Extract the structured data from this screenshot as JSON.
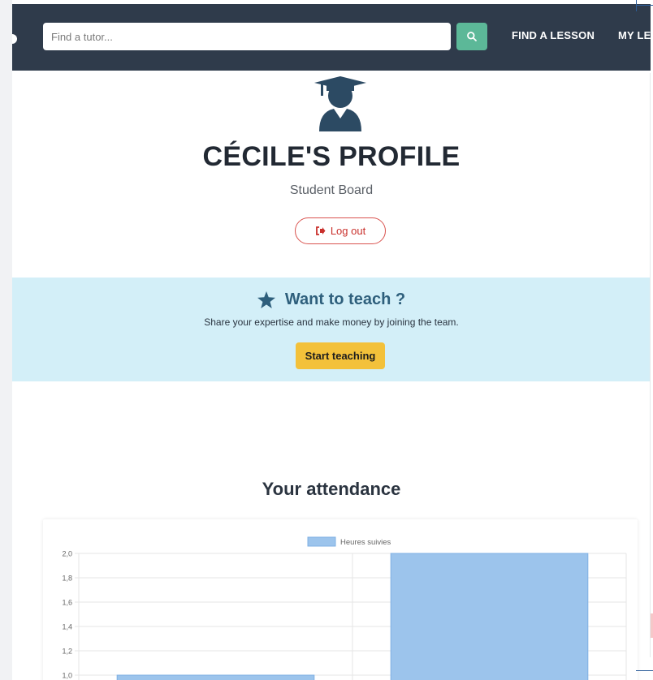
{
  "navbar": {
    "search": {
      "placeholder": "Find a tutor..."
    },
    "search_icon": "search-icon",
    "links": [
      "FIND A LESSON",
      "MY LE"
    ]
  },
  "profile": {
    "avatar_icon": "graduate-icon",
    "title": "CÉCILE'S PROFILE",
    "subtitle": "Student Board",
    "logout_label": "Log out",
    "logout_icon": "sign-out-icon"
  },
  "teach": {
    "icon": "star-icon",
    "title": "Want to teach ?",
    "text": "Share your expertise and make money by joining the team.",
    "button": "Start teaching"
  },
  "attendance": {
    "title": "Your attendance"
  },
  "colors": {
    "navbar": "#2f3b4b",
    "search_button": "#5cb898",
    "logout": "#d9534f",
    "banner": "#d3eff8",
    "teach_button": "#f3c13a",
    "bar": "#9cc4ec"
  },
  "chart_data": {
    "type": "bar",
    "categories": [
      "",
      ""
    ],
    "series": [
      {
        "name": "Heures suivies",
        "values": [
          1.0,
          2.0
        ]
      }
    ],
    "legend": "top-center",
    "ylim": [
      1.0,
      2.0
    ],
    "yticks": [
      "2,0",
      "1,8",
      "1,6",
      "1,4",
      "1,2",
      "1,0"
    ],
    "grid": true
  }
}
